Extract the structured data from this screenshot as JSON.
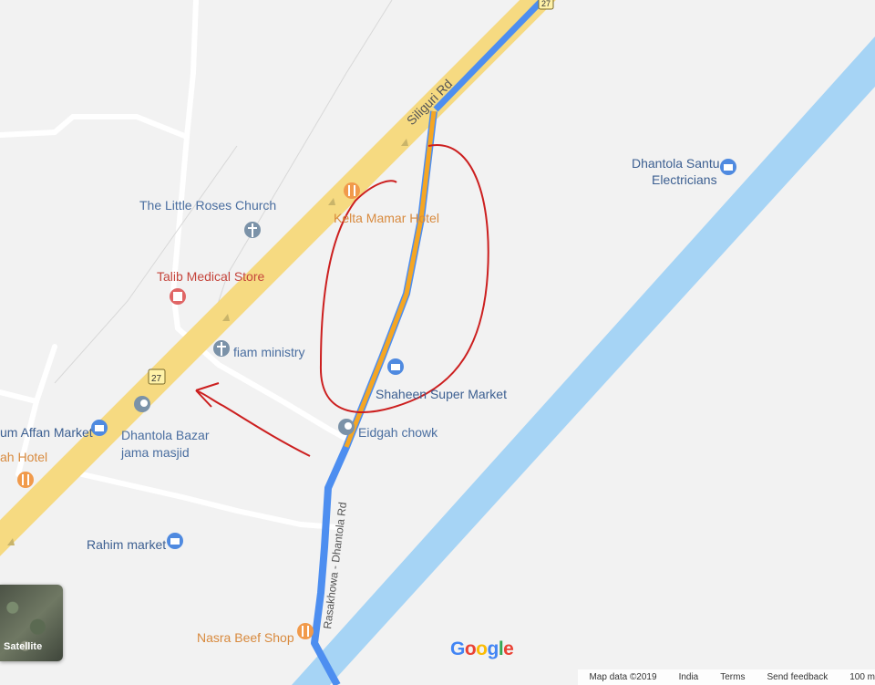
{
  "map": {
    "highway_shield": "27",
    "road_labels": {
      "siliguri_rd": "Siliguri Rd",
      "rasakhowa_rd": "Rasakhowa - Dhantola Rd"
    },
    "pois": {
      "little_roses": "The Little Roses Church",
      "talib_medical": "Talib Medical Store",
      "fiam_ministry": "fiam ministry",
      "kelta_mamar": "Kelta Mamar Hotel",
      "shaheen": "Shaheen Super Market",
      "eidgah": "Eidgah chowk",
      "affan_market": "um Affan Market",
      "dhantola_bazar_1": "Dhantola Bazar",
      "dhantola_bazar_2": "jama masjid",
      "ah_hotel": "ah Hotel",
      "rahim_market": "Rahim market",
      "nasra_beef": "Nasra Beef Shop",
      "santu_1": "Dhantola Santu",
      "santu_2": "Electricians"
    },
    "satellite_label": "Satellite",
    "footer": {
      "map_data": "Map data ©2019",
      "region": "India",
      "terms": "Terms",
      "feedback": "Send feedback",
      "scale": "100 m"
    },
    "google_logo": [
      "G",
      "o",
      "o",
      "g",
      "l",
      "e"
    ],
    "colors": {
      "highway": "#fbe08a",
      "route": "#4d8ef0",
      "route_highlight": "#f5a623",
      "river": "#a6d4f5",
      "annotation": "#cc1f1f"
    }
  }
}
